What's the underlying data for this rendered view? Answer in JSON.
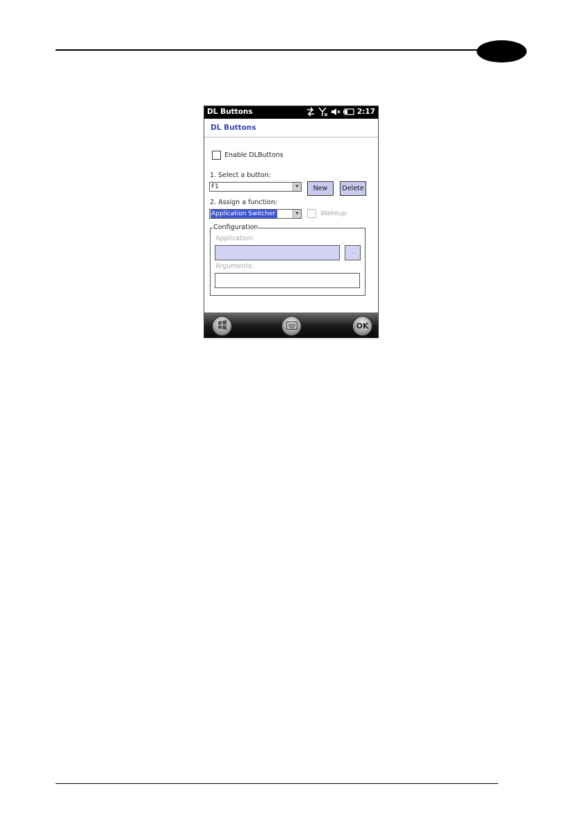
{
  "device": {
    "status_bar": {
      "title": "DL Buttons",
      "time": "2:17"
    },
    "header": {
      "title": "DL Buttons"
    },
    "form": {
      "enable_label": "Enable DLButtons",
      "select_button_label": "1. Select a button:",
      "selected_button": "F1",
      "new_label": "New",
      "delete_label": "Delete",
      "assign_function_label": "2. Assign a function:",
      "selected_function": "Application Switcher",
      "wakeup_label": "Wakeup",
      "configuration_label": "Configuration",
      "application_label": "Application:",
      "browse_label": "...",
      "arguments_label": "Arguments:"
    },
    "taskbar": {
      "ok_label": "OK"
    }
  }
}
